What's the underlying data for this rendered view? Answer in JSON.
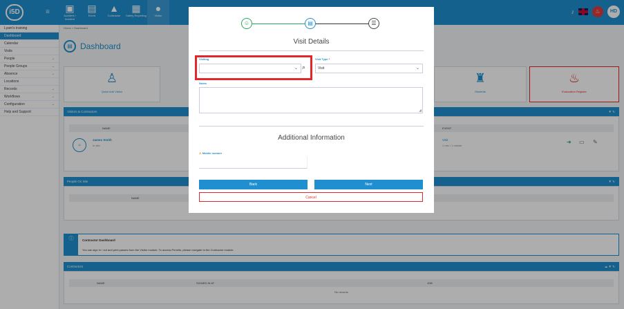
{
  "topbar": {
    "logo": "i5D",
    "nav": [
      {
        "label": "Accident / Incident",
        "glyph": "▣",
        "active": false
      },
      {
        "label": "Event",
        "glyph": "▤",
        "active": false
      },
      {
        "label": "Contractor",
        "glyph": "▲",
        "active": false
      },
      {
        "label": "Safety Reporting",
        "glyph": "▦",
        "active": false
      },
      {
        "label": "Visitor",
        "glyph": "●",
        "active": true
      }
    ],
    "user_initials": "HD"
  },
  "sidebar": {
    "items": [
      {
        "label": "Lyam's training",
        "active": false,
        "chevron": false
      },
      {
        "label": "Dashboard",
        "active": true,
        "chevron": false
      },
      {
        "label": "Calendar",
        "active": false,
        "chevron": false
      },
      {
        "label": "Visits",
        "active": false,
        "chevron": false
      },
      {
        "label": "People",
        "active": false,
        "chevron": true
      },
      {
        "label": "People Groups",
        "active": false,
        "chevron": true
      },
      {
        "label": "Absence",
        "active": false,
        "chevron": true
      },
      {
        "label": "Locations",
        "active": false,
        "chevron": false
      },
      {
        "label": "Records",
        "active": false,
        "chevron": true
      },
      {
        "label": "Workflows",
        "active": false,
        "chevron": true
      },
      {
        "label": "Configuration",
        "active": false,
        "chevron": true
      },
      {
        "label": "Help and Support",
        "active": false,
        "chevron": false
      }
    ]
  },
  "breadcrumb": "Home > Dashboard",
  "page_title": "Dashboard",
  "tiles": [
    {
      "label": "Quick Add Visitor",
      "glyph": "♙"
    },
    {
      "label": "Students",
      "glyph": "♜"
    },
    {
      "label": "Evacuation Register",
      "glyph": "♨"
    }
  ],
  "visitors_panel": {
    "title": "Visitors & Contractors",
    "col_name": "NAME",
    "col_event": "EVENT",
    "row_name": "James Smith",
    "row_sub": "In site",
    "row_event": "Visit",
    "row_event_sub": "1 min / 1 minute"
  },
  "people_panel": {
    "title": "People On Site",
    "col_name": "NAME"
  },
  "contractor_notice": {
    "title": "Contractor Dashboard",
    "body": "You can sign in / out and print passes from the Visitor module. To access Permits, please navigate to the Contractor module."
  },
  "contractors_panel": {
    "title": "Contractors",
    "cols": [
      "NAME",
      "SIGNED IN AT",
      "JOB"
    ],
    "empty": "No records"
  },
  "modal": {
    "heading": "Visit Details",
    "visiting_label": "Visiting",
    "visiting_value": "",
    "visit_type_label": "Visit Type",
    "visit_type_required": "*",
    "visit_type_value": "Visit",
    "notes_label": "Notes",
    "additional_heading": "Additional Information",
    "mobile_label": "Mobile number",
    "back_label": "Back",
    "next_label": "Next",
    "cancel_label": "Cancel"
  },
  "colors": {
    "accent": "#1f8fd0",
    "success": "#27a85a",
    "danger": "#e3262a"
  }
}
